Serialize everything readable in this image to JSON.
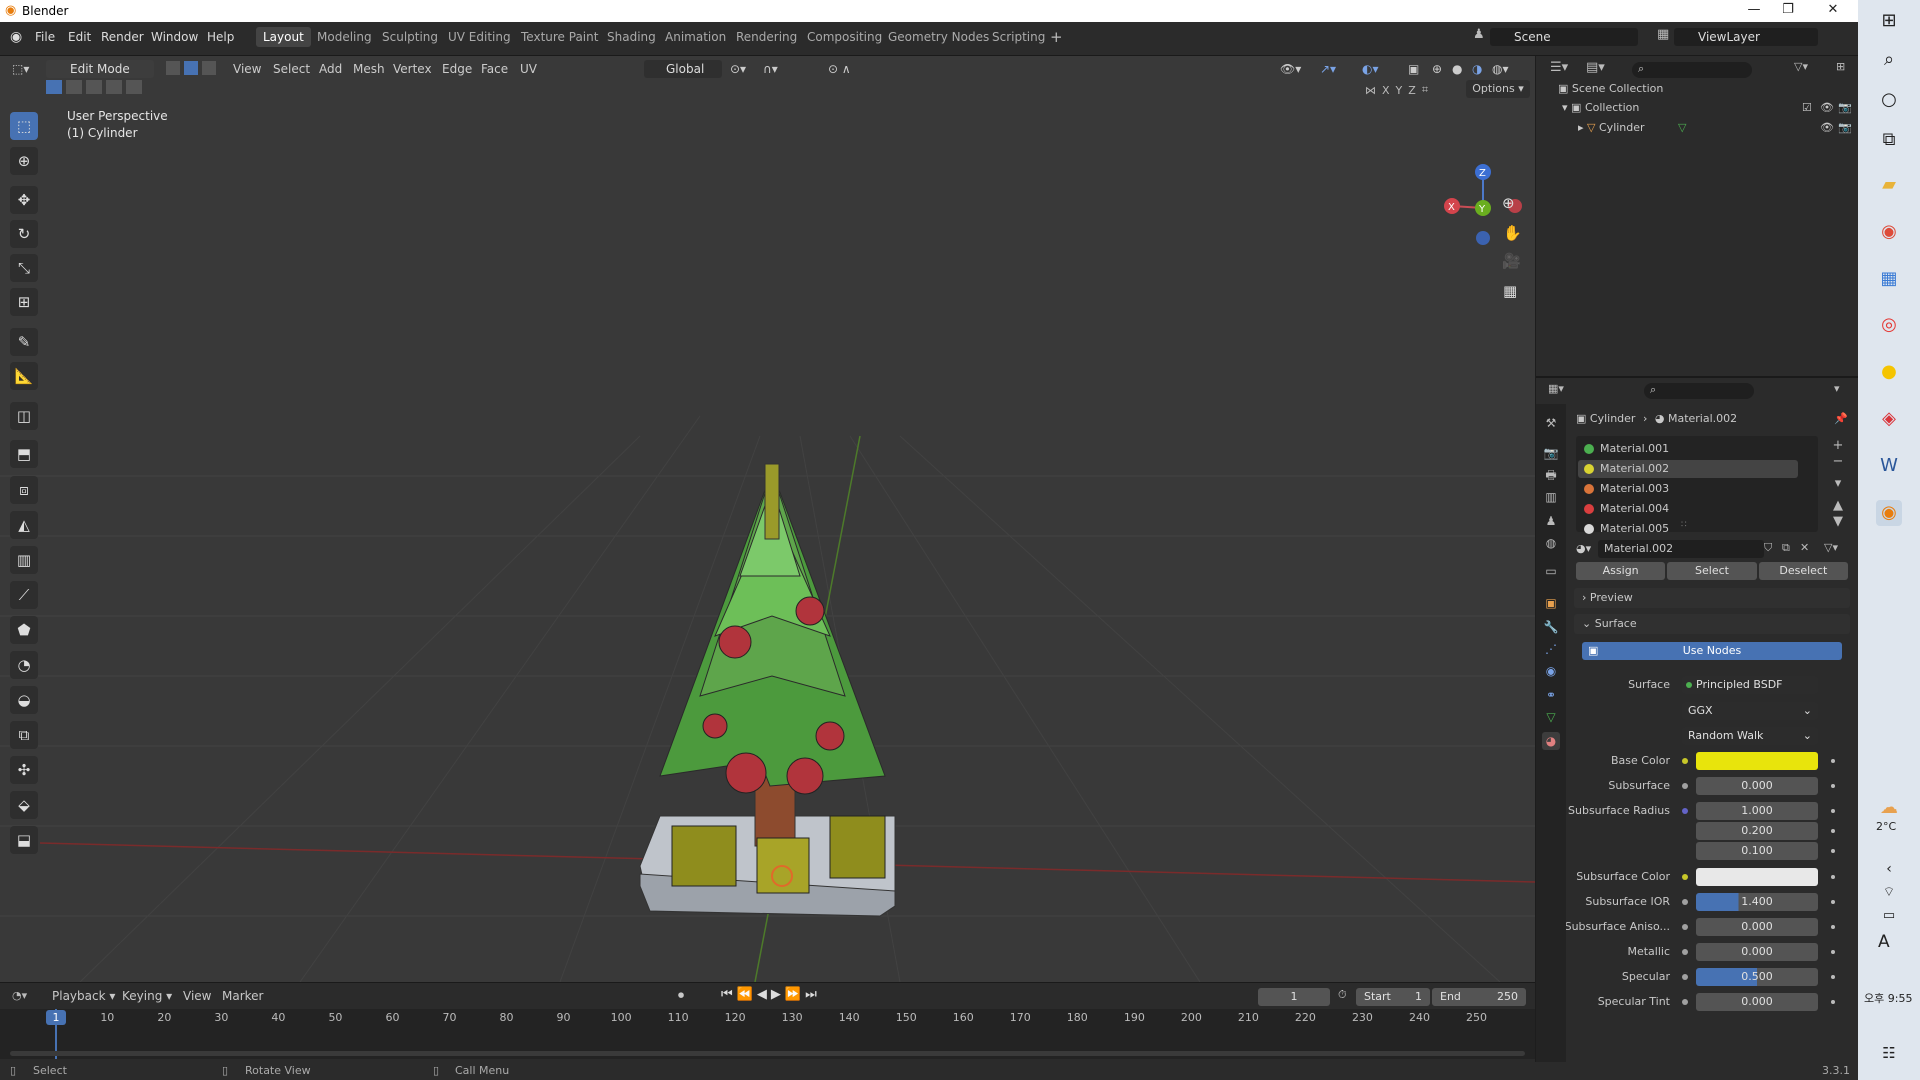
{
  "window": {
    "title": "Blender",
    "version": "3.3.1"
  },
  "menu": {
    "items": [
      "File",
      "Edit",
      "Render",
      "Window",
      "Help"
    ]
  },
  "workspaces": [
    "Layout",
    "Modeling",
    "Sculpting",
    "UV Editing",
    "Texture Paint",
    "Shading",
    "Animation",
    "Rendering",
    "Compositing",
    "Geometry Nodes",
    "Scripting"
  ],
  "scene": {
    "name": "Scene",
    "view_layer": "ViewLayer"
  },
  "viewport": {
    "mode": "Edit Mode",
    "header_menus": [
      "View",
      "Select",
      "Add",
      "Mesh",
      "Vertex",
      "Edge",
      "Face",
      "UV"
    ],
    "transform": "Global",
    "overlay_text1": "User Perspective",
    "overlay_text2": "(1) Cylinder",
    "axes": {
      "x": "X",
      "y": "Y",
      "z": "Z"
    },
    "options_label": "Options"
  },
  "outliner": {
    "scene_collection": "Scene Collection",
    "collection": "Collection",
    "object": "Cylinder"
  },
  "properties": {
    "breadcrumb_object": "Cylinder",
    "breadcrumb_material": "Material.002",
    "materials": [
      {
        "name": "Material.001",
        "color": "#4caf50"
      },
      {
        "name": "Material.002",
        "color": "#d9d332"
      },
      {
        "name": "Material.003",
        "color": "#d9743a"
      },
      {
        "name": "Material.004",
        "color": "#d93f3f"
      },
      {
        "name": "Material.005",
        "color": "#d9d9d9"
      }
    ],
    "active_material": "Material.002",
    "assign": "Assign",
    "select": "Select",
    "deselect": "Deselect",
    "preview_label": "Preview",
    "surface_label": "Surface",
    "use_nodes": "Use Nodes",
    "surface_field_label": "Surface",
    "surface_shader": "Principled BSDF",
    "distribution": "GGX",
    "subsurface_method": "Random Walk",
    "rows": [
      {
        "label": "Base Color",
        "value": "",
        "color": "#e8e40c"
      },
      {
        "label": "Subsurface",
        "value": "0.000"
      },
      {
        "label": "Subsurface Radius",
        "value": "1.000"
      },
      {
        "label": "",
        "value": "0.200"
      },
      {
        "label": "",
        "value": "0.100"
      },
      {
        "label": "Subsurface Color",
        "value": "",
        "color": "#e8e8e8"
      },
      {
        "label": "Subsurface IOR",
        "value": "1.400"
      },
      {
        "label": "Subsurface Aniso...",
        "value": "0.000"
      },
      {
        "label": "Metallic",
        "value": "0.000"
      },
      {
        "label": "Specular",
        "value": "0.500"
      },
      {
        "label": "Specular Tint",
        "value": "0.000"
      }
    ]
  },
  "timeline": {
    "menus": [
      "Playback",
      "Keying",
      "View",
      "Marker"
    ],
    "current_frame": "1",
    "start_label": "Start",
    "start": "1",
    "end_label": "End",
    "end": "250",
    "ticks": [
      "1",
      "10",
      "20",
      "30",
      "40",
      "50",
      "60",
      "70",
      "80",
      "90",
      "100",
      "110",
      "120",
      "130",
      "140",
      "150",
      "160",
      "170",
      "180",
      "190",
      "200",
      "210",
      "220",
      "230",
      "240",
      "250"
    ]
  },
  "status": {
    "select": "Select",
    "rotate": "Rotate View",
    "menu": "Call Menu"
  },
  "taskbar": {
    "temp": "2°C",
    "clock": "오후 9:55",
    "ime": "A"
  }
}
